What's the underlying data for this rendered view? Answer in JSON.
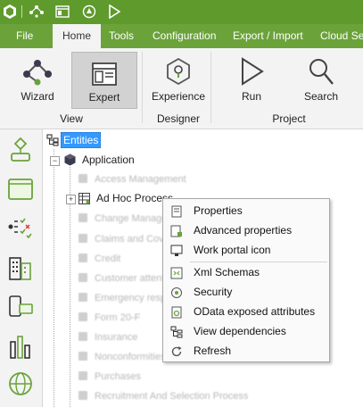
{
  "menu": {
    "items": [
      {
        "label": "File"
      },
      {
        "label": "Home"
      },
      {
        "label": "Tools"
      },
      {
        "label": "Configuration"
      },
      {
        "label": "Export / Import"
      },
      {
        "label": "Cloud Ser"
      }
    ],
    "active": "Home"
  },
  "ribbon": {
    "buttons": [
      {
        "label": "Wizard"
      },
      {
        "label": "Expert"
      },
      {
        "label": "Experience"
      },
      {
        "label": "Run"
      },
      {
        "label": "Search"
      }
    ],
    "groups": [
      {
        "label": "View"
      },
      {
        "label": "Designer"
      },
      {
        "label": "Project"
      }
    ]
  },
  "tree": {
    "root": "Entities",
    "application": "Application",
    "children": [
      {
        "label": "Access Management"
      },
      {
        "label": "Ad Hoc Process"
      },
      {
        "label": "Change Management"
      },
      {
        "label": "Claims and Coverage"
      },
      {
        "label": "Credit"
      },
      {
        "label": "Customer attention"
      },
      {
        "label": "Emergency response"
      },
      {
        "label": "Form 20-F"
      },
      {
        "label": "Insurance"
      },
      {
        "label": "Nonconformities"
      },
      {
        "label": "Purchases"
      },
      {
        "label": "Recruitment And Selection Process"
      }
    ]
  },
  "context_menu": {
    "items": [
      {
        "label": "Properties"
      },
      {
        "label": "Advanced properties"
      },
      {
        "label": "Work portal icon"
      },
      {
        "label": "Xml Schemas"
      },
      {
        "label": "Security"
      },
      {
        "label": "OData exposed attributes"
      },
      {
        "label": "View dependencies"
      },
      {
        "label": "Refresh"
      }
    ]
  },
  "colors": {
    "brand": "#5f9a2d",
    "menu": "#6ba33a",
    "selection": "#3399ff"
  }
}
